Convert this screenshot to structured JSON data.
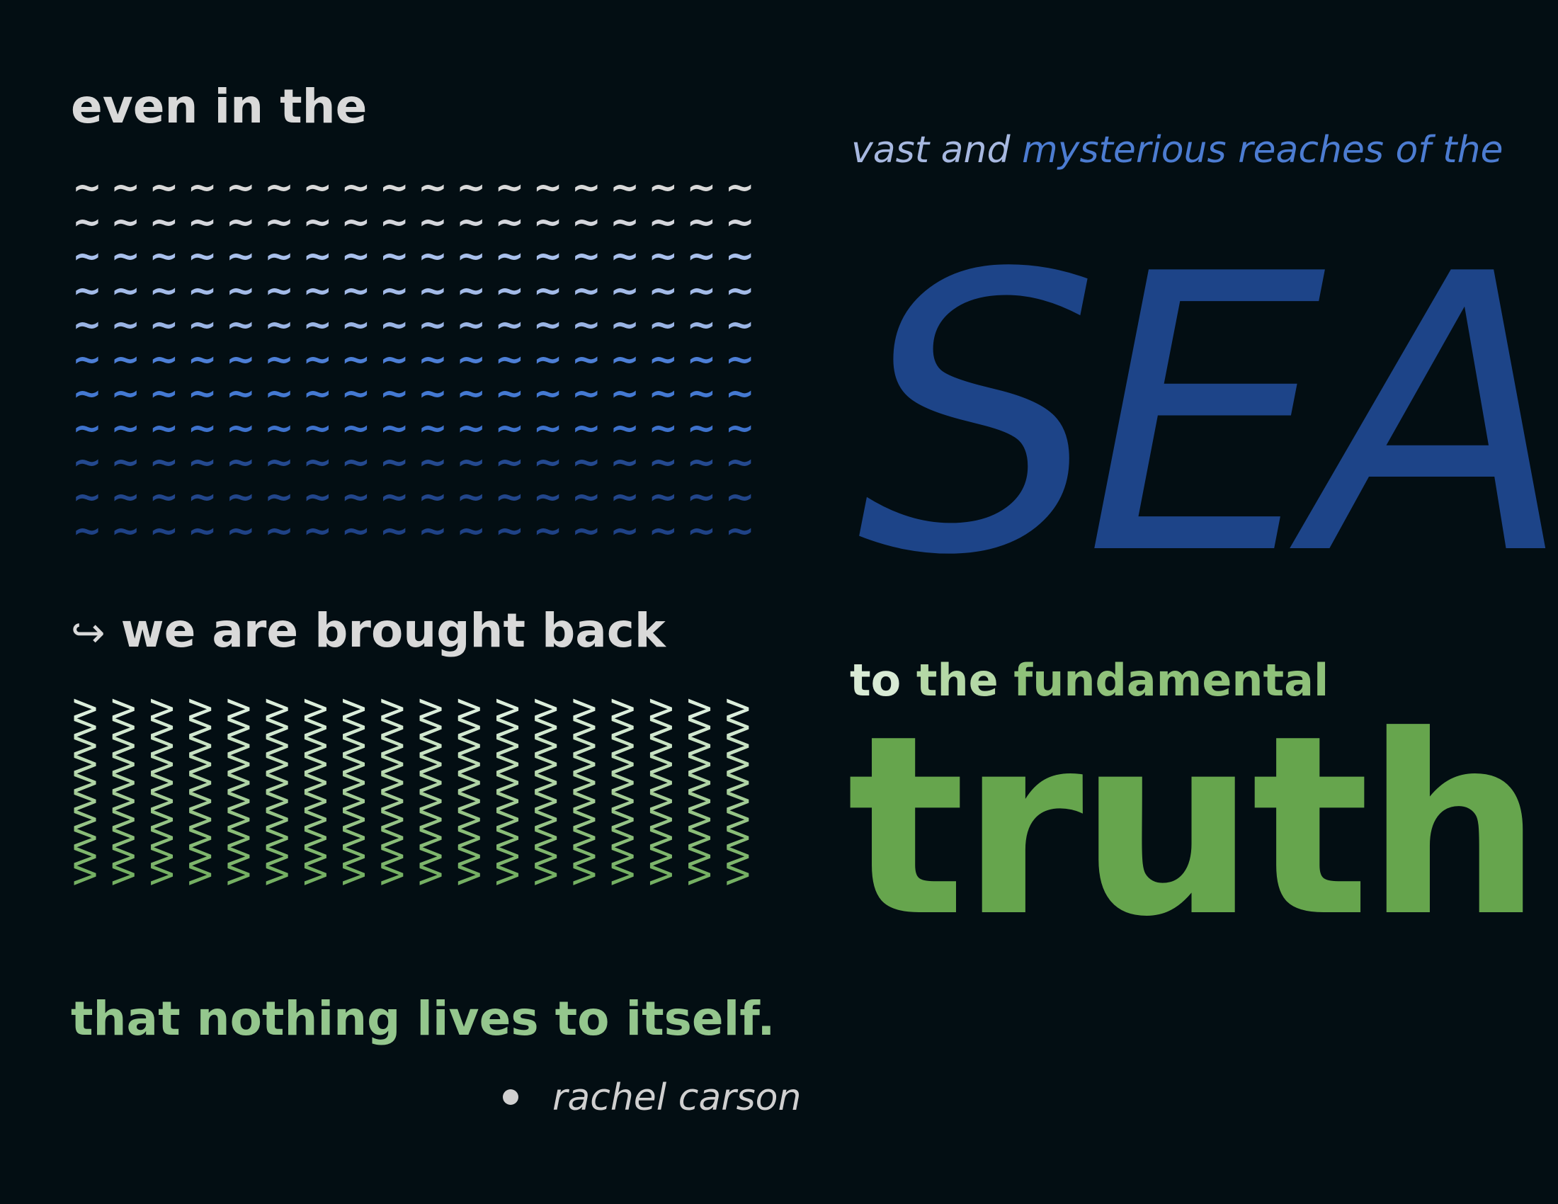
{
  "quote": {
    "line1": "even in the",
    "line2_prefix": "vast and",
    "line2_accent": "mysterious reaches of the",
    "sea": "SEA",
    "line3_arrow": "↪",
    "line3": "we are brought back",
    "line4_w1": "to",
    "line4_w2": "the",
    "line4_w3": "fundamental",
    "truth": "truth",
    "line5": "that nothing lives to itself.",
    "author": "rachel carson"
  },
  "waves": {
    "glyph": "~",
    "per_row": 18,
    "row_colors": [
      "#d9d9d9",
      "#d4d6dc",
      "#a9c0ec",
      "#a3bbe8",
      "#9ab4e4",
      "#4d7fd6",
      "#4479d2",
      "#3e72cc",
      "#24498f",
      "#22468b",
      "#1f4286"
    ]
  },
  "chevrons": {
    "glyph": ">",
    "per_row": 18,
    "row_colors": [
      "#dceedc",
      "#d3e9d1",
      "#c9e3c4",
      "#bddcb5",
      "#b0d4a5",
      "#a3cc95",
      "#96c486",
      "#8abd78",
      "#7fb66d",
      "#75b063"
    ]
  },
  "colors": {
    "background": "#030e13",
    "light_text": "#d9d9d9",
    "sea_blue": "#1d4488",
    "sky_blue": "#4c7cd1",
    "truth_green": "#66a54d",
    "light_green": "#94c68d"
  }
}
